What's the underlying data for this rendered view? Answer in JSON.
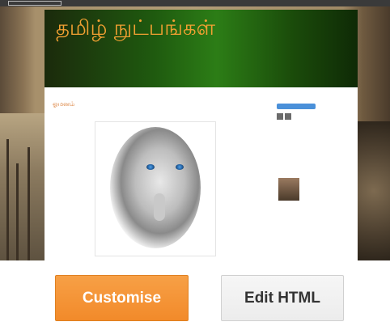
{
  "preview": {
    "topbar": {
      "left_text": "",
      "right_text": ""
    },
    "blog": {
      "title": "தமிழ் நுட்பங்கள்",
      "description": "",
      "post_title": "ஓமனம்"
    }
  },
  "actions": {
    "customise_label": "Customise",
    "edit_html_label": "Edit HTML"
  },
  "colors": {
    "customise_bg": "#f28a2a",
    "edit_html_bg": "#eeeeee",
    "blog_title": "#f2a032",
    "header_green": "#1f5a0f"
  }
}
